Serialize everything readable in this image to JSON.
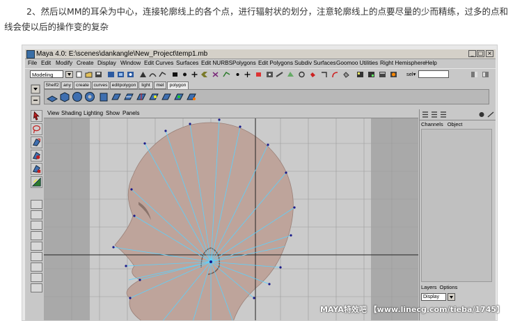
{
  "article": {
    "paragraph": "2、然后以MM的耳朵为中心，连接轮廓线上的各个点，进行辐射状的划分，注意轮廓线上的点要尽量的少而精练，过多的点和线会使以后的操作变的复杂"
  },
  "maya": {
    "title": "Maya 4.0: E:\\scenes\\dankangle\\New_Project\\temp1.mb",
    "window_buttons": [
      "_",
      "□",
      "×"
    ],
    "menus": [
      "File",
      "Edit",
      "Modify",
      "Create",
      "Display",
      "Window",
      "Edit Curves",
      "Surfaces",
      "Edit NURBS",
      "Polygons",
      "Edit Polygons",
      "Subdiv Surfaces",
      "Goomoo Utilities",
      "Right Hemisphere",
      "Help"
    ],
    "mode_menu": "Modeling",
    "sel_label": "sel▾",
    "shelf_tabs": [
      "Shelf2",
      "any",
      "create",
      "curves",
      "editpolygon",
      "light",
      "mel",
      "polygon"
    ],
    "active_shelf": "polygon",
    "panel_menu": [
      "View",
      "Shading",
      "Lighting",
      "Show",
      "Panels"
    ],
    "channel_box": {
      "tabs": [
        "Channels",
        "Object"
      ],
      "layer_tabs": [
        "Layers",
        "Options"
      ],
      "display_option": "Display"
    },
    "icons": {
      "select": "select-arrow-icon",
      "lasso": "lasso-icon",
      "move": "move-tool-icon",
      "rotate": "rotate-tool-icon",
      "scale": "scale-tool-icon",
      "manipulator": "manipulator-icon"
    }
  },
  "watermark": "MAYA特效吧 【www.linecg.com/tieba/1745】",
  "colors": {
    "maya_bg": "#c8c8c8",
    "viewport_bg": "#cbcbcb",
    "head_fill": "#bea49b",
    "wire": "#5ad2ff",
    "vertex": "#1a1a8a"
  }
}
